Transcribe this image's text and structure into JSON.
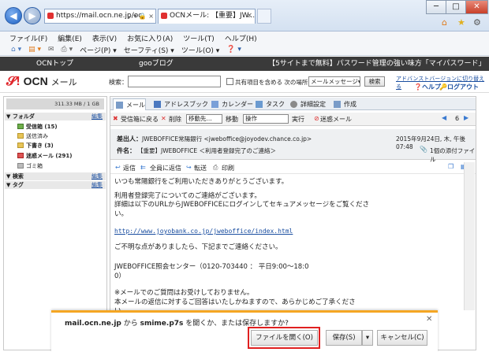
{
  "browser": {
    "address": "https://mail.ocn.ne.jp/oc",
    "address_controls": "♀ ▾ 🔒 ×",
    "tab_title": "OCNメール: 【重要】JW...",
    "menu": [
      "ファイル(F)",
      "編集(E)",
      "表示(V)",
      "お気に入り(A)",
      "ツール(T)",
      "ヘルプ(H)"
    ],
    "commands": [
      "ページ(P) ▾",
      "セーフティ(S) ▾",
      "ツール(O) ▾"
    ]
  },
  "portal": {
    "top_left": "OCNトップ",
    "goo": "gooブログ",
    "ad": "【5サイトまで無料】パスワード管理の強い味方「マイパスワード」"
  },
  "app": {
    "logo": "OCN",
    "logo_suffix": "メール",
    "search_label": "検索：",
    "search_value": "",
    "share_label": "共有項目を含める",
    "search_scope_label": "次の場所内",
    "search_scope": "メールメッセージ",
    "search_button": "検索",
    "advanced_link": "アドバンストバージョンに切り替える",
    "help": "ヘルプ",
    "logout": "ログアウト"
  },
  "sidebar": {
    "quota": "311.33 MB / 1 GB",
    "folder_header": "フォルダ",
    "edit": "編集",
    "folders": [
      {
        "label": "受信箱 (15)",
        "bold": true
      },
      {
        "label": "送信済み",
        "bold": false
      },
      {
        "label": "下書き (3)",
        "bold": true
      },
      {
        "label": "迷惑メール (291)",
        "bold": true
      },
      {
        "label": "ゴミ箱",
        "bold": false
      }
    ],
    "search_header": "検索",
    "tag_header": "タグ"
  },
  "tabs": [
    "メール",
    "アドレスブック",
    "カレンダー",
    "タスク",
    "詳細設定",
    "作成"
  ],
  "actions": {
    "back": "受信箱に戻る",
    "delete": "削除",
    "move_select": "移動先...",
    "move": "移動",
    "op_select": "操作",
    "exec": "実行",
    "spam": "迷惑メール",
    "page": "6"
  },
  "message": {
    "from_label": "差出人：",
    "from": "JWEBOFFICE常陽銀行 <jweboffice@joyodev.chance.co.jp>",
    "date": "2015年9月24日, 木, 午後 07:48",
    "subject_label": "件名：",
    "subject": "【重要】JWEBOFFICE ＜利用者登録完了のご連絡＞",
    "attachment": "1個の添付ファイル",
    "reply": "返信",
    "reply_all": "全員に返信",
    "forward": "転送",
    "print": "印刷",
    "body_1": "いつも常陽銀行をご利用いただきありがとうございます。",
    "body_2": "利用者登録完了についてのご連絡がございます。\n詳細は以下のURLからJWEBOFFICEにログインしてセキュアメッセージをご覧くださ\nい。",
    "link": "http://www.joyobank.co.jp/jweboffice/index.html",
    "body_3": "ご不明な点がありましたら、下記までご連絡ください。",
    "body_4": "JWEBOFFICE照会センター（0120-703440 ： 平日9:00～18:0\n0）",
    "body_5": "※メールでのご質問はお受けしておりません。\n本メールの返信に対するご回答はいたしかねますので、あらかじめご了承くださ\nい。"
  },
  "download": {
    "host": "mail.ocn.ne.jp",
    "from_word": "から",
    "file": "smime.p7s",
    "prompt": "を開くか、または保存しますか?",
    "open": "ファイルを開く(O)",
    "save": "保存(S)",
    "cancel": "キャンセル(C)"
  },
  "colors": {
    "accent": "#e0262b",
    "link": "#1a4ea0",
    "highlight": "#e02020",
    "notify": "#f5a623"
  }
}
